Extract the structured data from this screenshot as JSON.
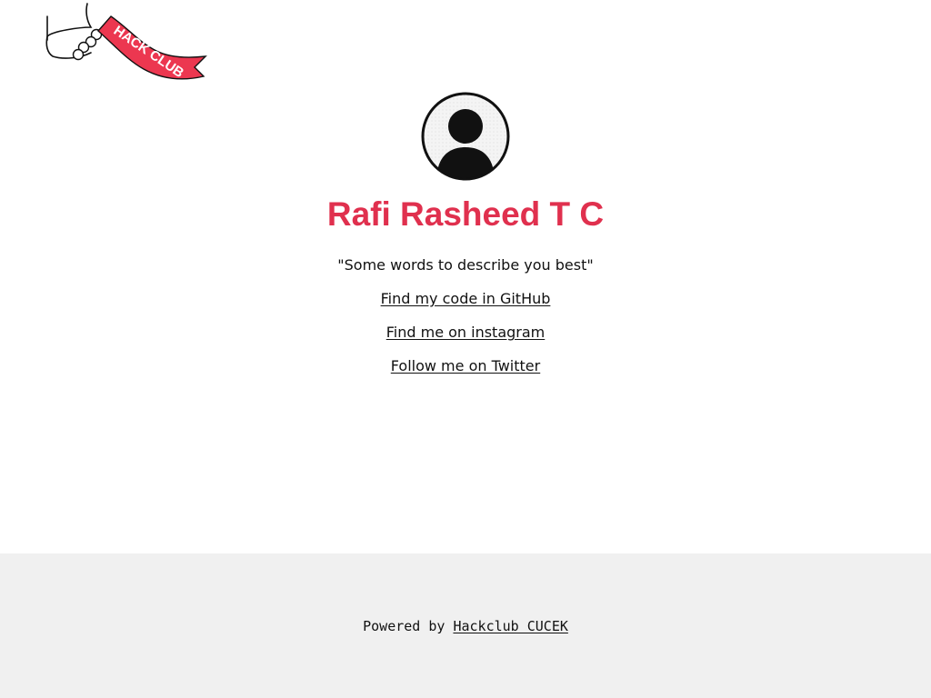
{
  "logo": {
    "text": "HACK CLUB",
    "color": "#ec3750"
  },
  "profile": {
    "avatar_icon": "user-silhouette-icon",
    "name": "Rafi Rasheed T C",
    "name_color": "#e0304e",
    "tagline": "\"Some words to describe you best\""
  },
  "links": [
    {
      "label": "Find my code in GitHub"
    },
    {
      "label": "Find me on instagram"
    },
    {
      "label": "Follow me on Twitter"
    }
  ],
  "footer": {
    "prefix": "Powered by",
    "link_label": "Hackclub CUCEK",
    "background": "#f0f0f0"
  }
}
